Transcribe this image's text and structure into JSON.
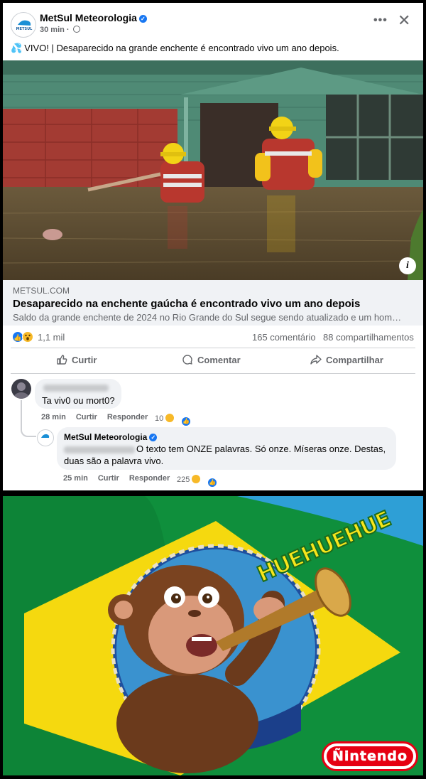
{
  "post": {
    "page_name": "MetSul Meteorologia",
    "time": "30 min",
    "text": "VIVO! | Desaparecido na grande enchente é encontrado vivo um ano depois.",
    "link": {
      "domain": "METSUL.COM",
      "title": "Desaparecido na enchente gaúcha é encontrado vivo um ano depois",
      "description": "Saldo da grande enchente de 2024 no Rio Grande do Sul segue sendo atualizado e um hom…"
    },
    "stats": {
      "reactions": "1,1 mil",
      "comments": "165 comentário",
      "shares": "88 compartilhamentos"
    },
    "actions": {
      "like": "Curtir",
      "comment": "Comentar",
      "share": "Compartilhar"
    },
    "avatar_text": "METSUL"
  },
  "comments": [
    {
      "text": "Ta viv0 ou mort0?",
      "time": "28 min",
      "like": "Curtir",
      "reply": "Responder",
      "reactions": "10"
    }
  ],
  "reply": {
    "author": "MetSul Meteorologia",
    "text": "O texto tem ONZE palavras. Só onze. Míseras onze. Destas, duas são a palavra vivo.",
    "time": "25 min",
    "like": "Curtir",
    "reply": "Responder",
    "reactions": "225"
  },
  "meme": {
    "caption": "HUEHUEHUE",
    "logo": "Ñintendo"
  },
  "colors": {
    "facebook_blue": "#1877f2",
    "flag_green": "#009b3a",
    "flag_yellow": "#fedf00",
    "flag_blue": "#002776"
  }
}
